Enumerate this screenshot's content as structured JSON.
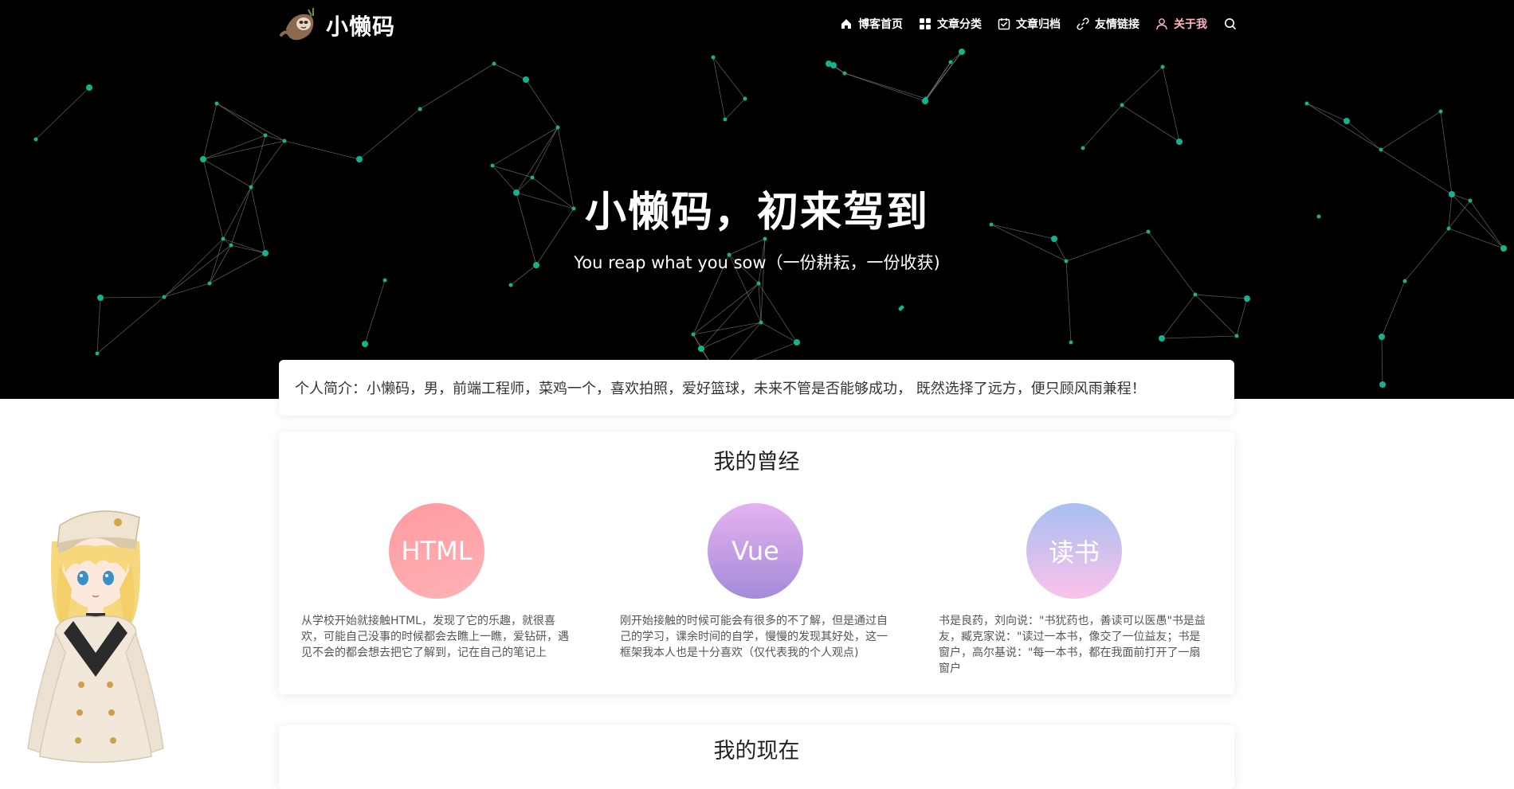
{
  "site": {
    "logo_text": "小懒码"
  },
  "nav": {
    "items": [
      {
        "label": "博客首页",
        "icon": "home-icon"
      },
      {
        "label": "文章分类",
        "icon": "grid-icon"
      },
      {
        "label": "文章归档",
        "icon": "archive-icon"
      },
      {
        "label": "友情链接",
        "icon": "link-icon"
      },
      {
        "label": "关于我",
        "icon": "user-icon"
      }
    ],
    "search_icon": "search-icon",
    "active_color": "#ffb3c1"
  },
  "hero": {
    "title": "小懒码，初来驾到",
    "subtitle": "You reap what you sow（一份耕耘，一份收获)"
  },
  "intro": {
    "text": "个人简介：小懒码，男，前端工程师，菜鸡一个，喜欢拍照，爱好篮球，未来不管是否能够成功， 既然选择了远方，便只顾风雨兼程！"
  },
  "past": {
    "title": "我的曾经",
    "skills": [
      {
        "label": "HTML",
        "desc": "从学校开始就接触HTML，发现了它的乐趣，就很喜欢，可能自己没事的时候都会去瞧上一瞧，爱钻研，遇见不会的都会想去把它了解到，记在自己的笔记上"
      },
      {
        "label": "Vue",
        "desc": "刚开始接触的时候可能会有很多的不了解，但是通过自己的学习，课余时间的自学，慢慢的发现其好处，这一框架我本人也是十分喜欢（仅代表我的个人观点)"
      },
      {
        "label": "读书",
        "desc": "书是良药，刘向说：\"书犹药也，善读可以医愚\"书是益友，臧克家说：\"读过一本书，像交了一位益友；书是窗户，高尔基说：\"每一本书，都在我面前打开了一扇窗户"
      }
    ]
  },
  "now": {
    "title": "我的现在"
  },
  "colors": {
    "hero_bg": "#000000",
    "node": "#16b28f"
  }
}
